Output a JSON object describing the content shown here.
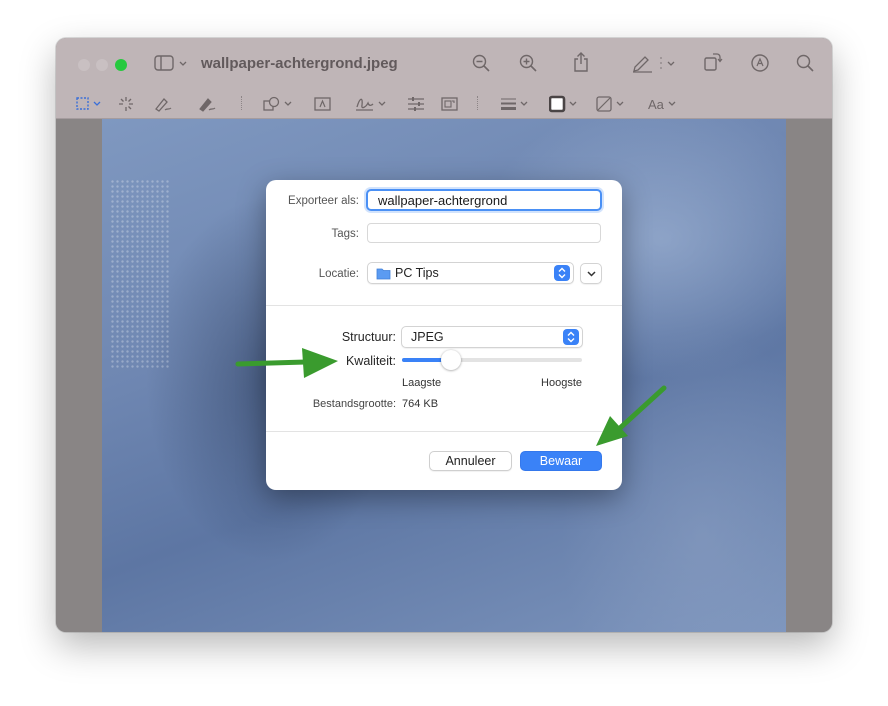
{
  "window": {
    "title": "wallpaper-achtergrond.jpeg",
    "traffic_lights": {
      "close": "#c9c0c2",
      "minimize": "#c9c0c2",
      "zoom": "#27c93f"
    }
  },
  "dialog": {
    "export_as_label": "Exporteer als:",
    "export_as_value": "wallpaper-achtergrond",
    "tags_label": "Tags:",
    "tags_value": "",
    "location_label": "Locatie:",
    "location_value": "PC Tips",
    "format_label": "Structuur:",
    "format_value": "JPEG",
    "quality_label": "Kwaliteit:",
    "quality_fraction": 0.27,
    "quality_min_label": "Laagste",
    "quality_max_label": "Hoogste",
    "filesize_label": "Bestandsgrootte:",
    "filesize_value": "764 KB",
    "cancel_label": "Annuleer",
    "save_label": "Bewaar"
  },
  "colors": {
    "accent": "#3a82f7",
    "annotation_arrow": "#3a9b2e"
  }
}
